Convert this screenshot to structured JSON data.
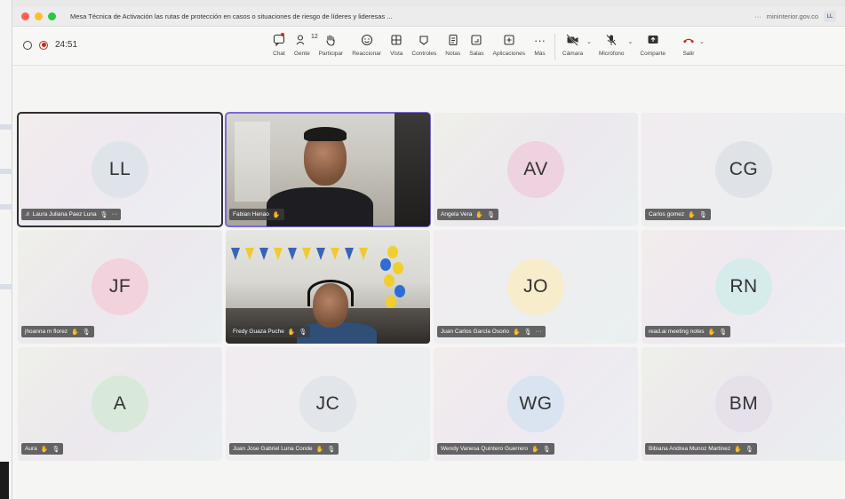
{
  "window": {
    "title": "Mesa Técnica de Activación las rutas de protección en casos o situaciones de riesgo de líderes y lideresas ...",
    "domain": "mininterior.gov.co",
    "more": "···",
    "user_initials": "LL"
  },
  "status": {
    "timer": "24:51"
  },
  "toolbar": {
    "chat": "Chat",
    "people": "Gente",
    "people_count": "12",
    "raise": "Participar",
    "react": "Reaccionar",
    "view": "Vista",
    "controls": "Controles",
    "notes": "Notas",
    "rooms": "Salas",
    "apps": "Aplicaciones",
    "more": "Más",
    "camera": "Cámara",
    "mic": "Micrófono",
    "share": "Comparte",
    "leave": "Salir"
  },
  "participants": [
    {
      "initials": "LL",
      "name": "Laura Juliana Paez Luna",
      "avatar_color": "#dfe4ea",
      "video": false
    },
    {
      "initials": "",
      "name": "Fabian Henao",
      "avatar_color": "",
      "video": true
    },
    {
      "initials": "AV",
      "name": "Angela Vera",
      "avatar_color": "#efd2df",
      "video": false
    },
    {
      "initials": "CG",
      "name": "Carlos gomez",
      "avatar_color": "#dfe3e8",
      "video": false
    },
    {
      "initials": "JF",
      "name": "jhoanna m florez",
      "avatar_color": "#f2d2dc",
      "video": false
    },
    {
      "initials": "",
      "name": "Fredy Guaza Puche",
      "avatar_color": "",
      "video": true
    },
    {
      "initials": "JO",
      "name": "Juan Carlos García Osorio",
      "avatar_color": "#f7eccb",
      "video": false
    },
    {
      "initials": "RN",
      "name": "read.ai meeting notes",
      "avatar_color": "#d6ecec",
      "video": false
    },
    {
      "initials": "A",
      "name": "Aura",
      "avatar_color": "#d8e9d9",
      "video": false
    },
    {
      "initials": "JC",
      "name": "Juan Jose Gabriel Luna Conde",
      "avatar_color": "#e2e5e9",
      "video": false
    },
    {
      "initials": "WG",
      "name": "Wendy Vanesa Quintero Guerrero",
      "avatar_color": "#d9e4f0",
      "video": false
    },
    {
      "initials": "BM",
      "name": "Bibiana Andrea Munoz Martinez",
      "avatar_color": "#e6e0ea",
      "video": false
    }
  ]
}
